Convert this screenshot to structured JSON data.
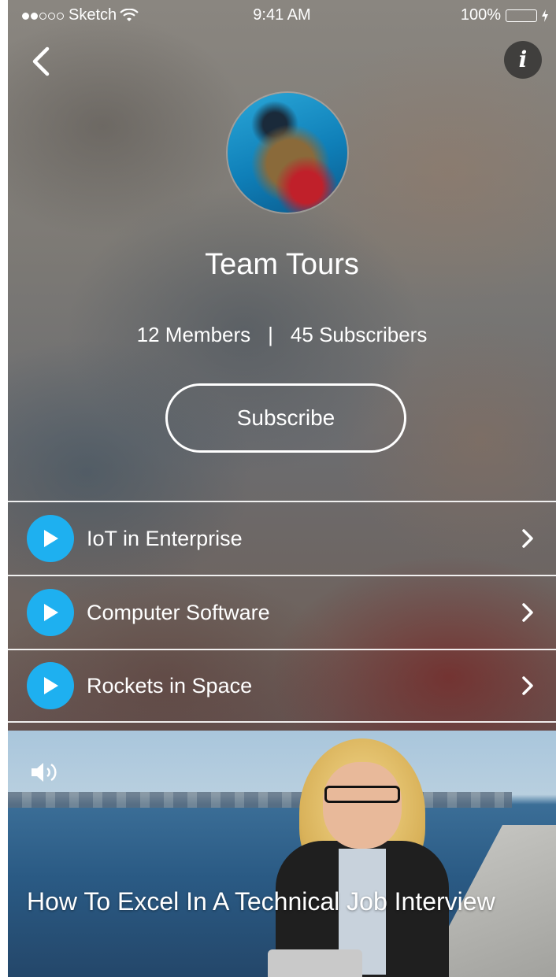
{
  "status_bar": {
    "carrier": "Sketch",
    "time": "9:41 AM",
    "battery": "100%",
    "signal_bars_filled": 2,
    "signal_bars_total": 5
  },
  "header": {
    "back_icon": "chevron-left-icon",
    "info_icon": "info-icon",
    "info_glyph": "i"
  },
  "profile": {
    "name": "Team Tours",
    "members": "12 Members",
    "separator": "|",
    "subscribers": "45 Subscribers",
    "subscribe_label": "Subscribe"
  },
  "channels": [
    {
      "label": "IoT in Enterprise"
    },
    {
      "label": "Computer Software"
    },
    {
      "label": "Rockets in Space"
    }
  ],
  "video": {
    "title": "How To Excel In A Technical Job Interview",
    "sound_icon": "speaker-icon"
  },
  "colors": {
    "accent": "#1EB0F0",
    "battery": "#4CD964",
    "text": "#FFFFFF"
  }
}
